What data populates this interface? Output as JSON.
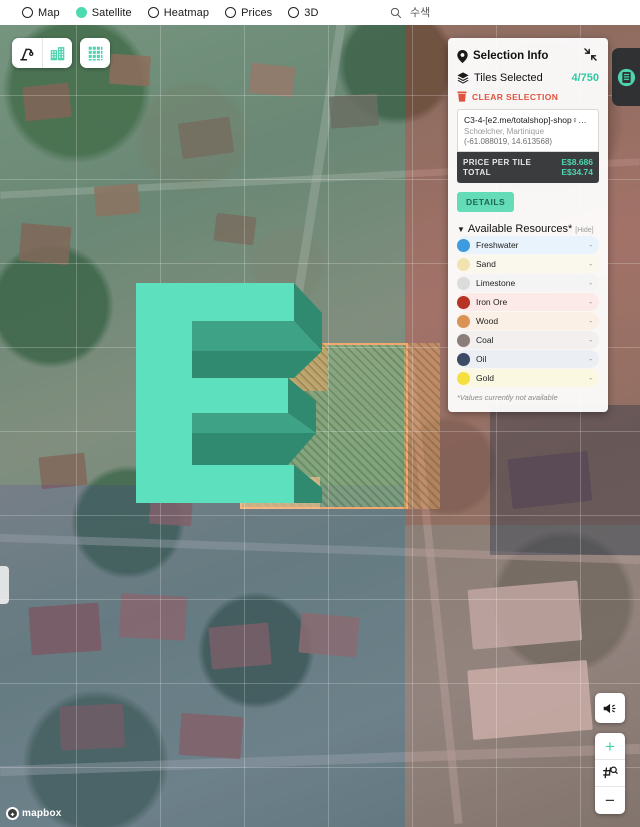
{
  "topbar": {
    "modes": [
      {
        "label": "Map",
        "selected": false,
        "icon": "radio-icon"
      },
      {
        "label": "Satellite",
        "selected": true,
        "icon": "radio-icon"
      },
      {
        "label": "Heatmap",
        "selected": false,
        "icon": "radio-icon"
      },
      {
        "label": "Prices",
        "selected": false,
        "icon": "radio-icon"
      },
      {
        "label": "3D",
        "selected": false,
        "icon": "radio-icon"
      }
    ],
    "search": {
      "placeholder": "수색",
      "value": "",
      "icon": "search-icon"
    }
  },
  "left_tools": [
    {
      "name": "crane-icon",
      "label": "Crane tool"
    },
    {
      "name": "building-icon",
      "label": "Buildings layer"
    },
    {
      "name": "grid-icon",
      "label": "Grid layer"
    }
  ],
  "right_tab": {
    "icon": "list-panel-icon",
    "label": "Open list panel"
  },
  "panel": {
    "title": "Selection Info",
    "title_icon": "map-pin-icon",
    "collapse_icon": "collapse-icon",
    "tiles_icon": "layers-icon",
    "tiles_label": "Tiles Selected",
    "tiles_value": "4/750",
    "clear_icon": "trash-icon",
    "clear_label": "CLEAR SELECTION",
    "tile": {
      "name": "C3-4-[e2.me/totalshop]-shop♀…",
      "place": "Schœlcher, Martinique",
      "coords": "(-61.088019, 14.613568)"
    },
    "prices": [
      {
        "label": "PRICE PER TILE",
        "value": "E$8.686"
      },
      {
        "label": "TOTAL",
        "value": "E$34.74"
      }
    ],
    "details_label": "DETAILS",
    "resources": {
      "caret": "▼",
      "title": "Available Resources*",
      "hide_label": "[Hide]",
      "items": [
        {
          "name": "Freshwater",
          "value": "-",
          "color": "#3d9ce0",
          "row_bg": "#e8f3fb"
        },
        {
          "name": "Sand",
          "value": "-",
          "color": "#f0e3b0",
          "row_bg": "#faf7ec"
        },
        {
          "name": "Limestone",
          "value": "-",
          "color": "#dcdcdc",
          "row_bg": "#f4f4f4"
        },
        {
          "name": "Iron Ore",
          "value": "-",
          "color": "#b73323",
          "row_bg": "#fbeae7"
        },
        {
          "name": "Wood",
          "value": "-",
          "color": "#d99354",
          "row_bg": "#fbf0e6"
        },
        {
          "name": "Coal",
          "value": "-",
          "color": "#8b7d77",
          "row_bg": "#f2efee"
        },
        {
          "name": "Oil",
          "value": "-",
          "color": "#3b4a66",
          "row_bg": "#ebeef3"
        },
        {
          "name": "Gold",
          "value": "-",
          "color": "#f6e040",
          "row_bg": "#fbf8e2"
        }
      ],
      "note": "*Values currently not available"
    }
  },
  "map_controls": {
    "announce": {
      "icon": "megaphone-icon",
      "label": "Announcements"
    },
    "zoom_in": {
      "icon": "plus-icon",
      "label": "+"
    },
    "grid_find": {
      "icon": "grid-search-icon",
      "label": "Find tile"
    },
    "zoom_out": {
      "icon": "minus-icon",
      "label": "−"
    }
  },
  "attribution": {
    "text": "mapbox",
    "icon": "mapbox-logo-icon"
  },
  "overlay_logo": {
    "name": "earth2-e-logo",
    "colors": {
      "face": "#5ce0be",
      "side": "#2f8a70",
      "top": "#3ea386"
    }
  },
  "theme": {
    "accent": "#4ddbb0",
    "accent_dark": "#2ec9a4",
    "danger": "#e0533f",
    "panel_dark": "#3a3c3e"
  }
}
